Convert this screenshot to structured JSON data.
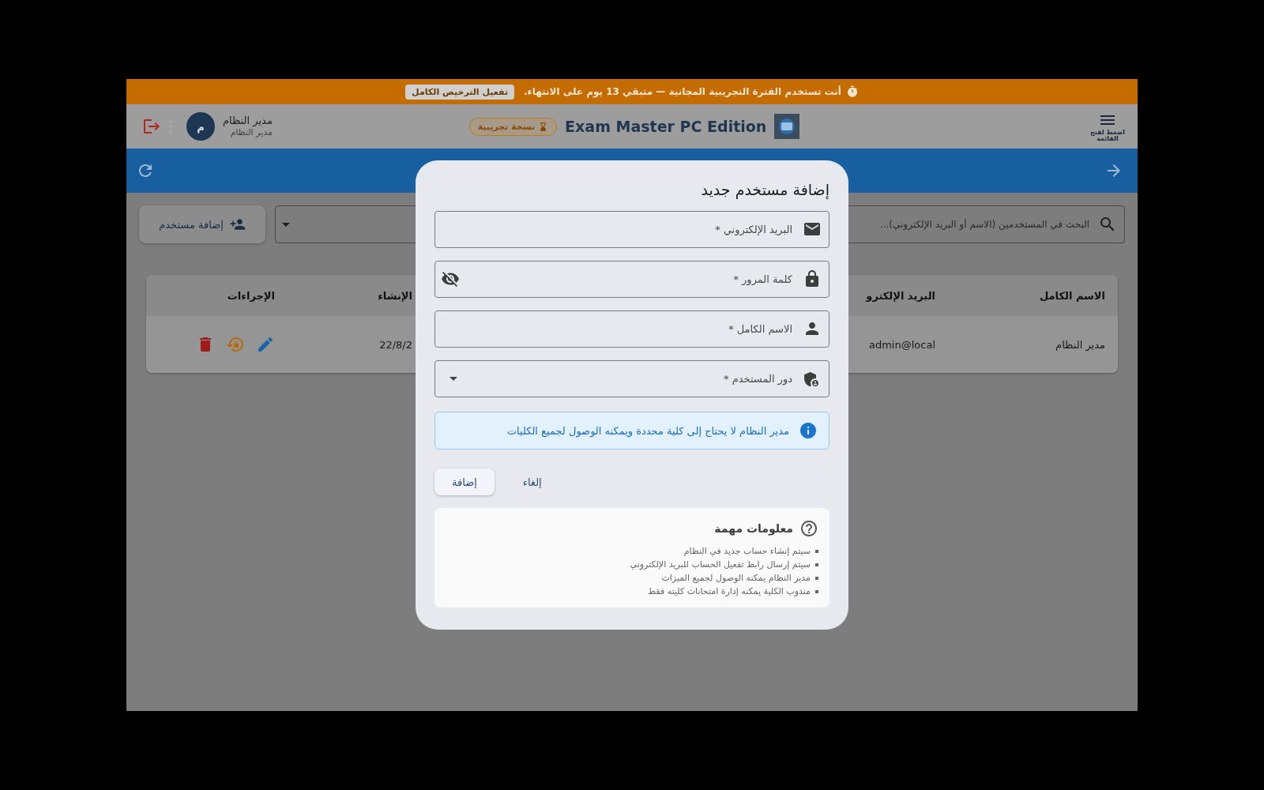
{
  "trial_banner": {
    "message": "أنت تستخدم الفترة التجريبية المجانية — متبقي 13 يوم على الانتهاء.",
    "activate_button": "تفعيل الترخيص الكامل"
  },
  "header": {
    "menu_label": "اضغط لفتح القائمة",
    "app_title": "Exam Master PC Edition",
    "badge": "نسخة تجريبية",
    "user": {
      "avatar_letter": "م",
      "name": "مدير النظام",
      "role": "مدير النظام"
    }
  },
  "toolbar": {
    "search": {
      "placeholder": "البحث في المستخدمين (الاسم أو البريد الإلكتروني)..."
    },
    "add_button": "إضافة مستخدم"
  },
  "table": {
    "columns": [
      "الاسم الكامل",
      "البريد الإلكترو",
      "الإنشاء",
      "الإجراءات"
    ],
    "rows": [
      {
        "cells": [
          "مدير النظام",
          "admin@local",
          "22/8/2"
        ]
      }
    ]
  },
  "dialog": {
    "title": "إضافة مستخدم جديد",
    "fields": [
      {
        "kind": "email",
        "placeholder": "البريد الإلكتروني *"
      },
      {
        "kind": "password",
        "placeholder": "كلمة المرور *"
      },
      {
        "kind": "name",
        "placeholder": "الاسم الكامل *"
      },
      {
        "kind": "select",
        "placeholder": "دور المستخدم *"
      }
    ],
    "alert": "مدير النظام لا يحتاج إلى كلية محددة ويمكنه الوصول لجميع الكليات",
    "buttons": [
      {
        "kind": "text",
        "label": "إلغاء"
      },
      {
        "kind": "contained",
        "label": "إضافة"
      }
    ],
    "info": {
      "title": "معلومات مهمة",
      "items": [
        "سيتم إنشاء حساب جديد في النظام",
        "سيتم إرسال رابط تفعيل الحساب للبريد الإلكتروني",
        "مدير النظام يمكنه الوصول لجميع الميزات",
        "مندوب الكلية يمكنه إدارة امتحانات كليته فقط"
      ]
    }
  }
}
